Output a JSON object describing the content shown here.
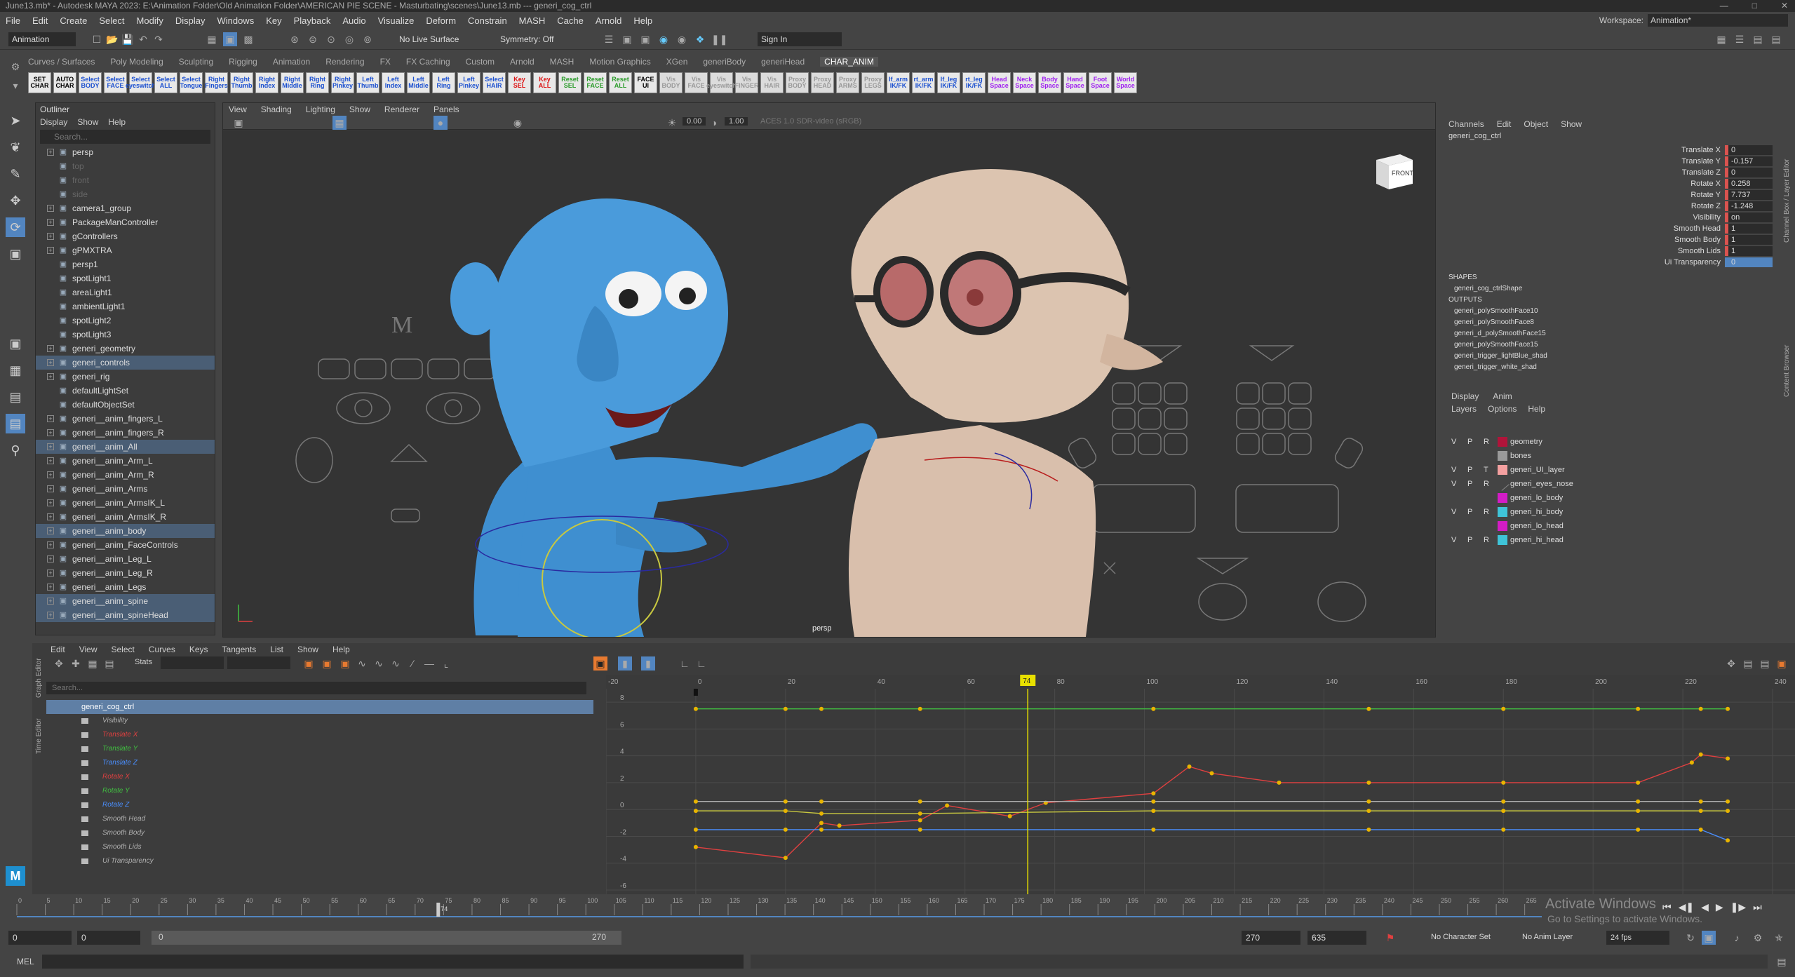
{
  "window": {
    "title": "June13.mb* - Autodesk MAYA 2023: E:\\Animation Folder\\Old Animation Folder\\AMERICAN PIE SCENE - Masturbating\\scenes\\June13.mb   ---   generi_cog_ctrl"
  },
  "menubar": {
    "items": [
      "File",
      "Edit",
      "Create",
      "Select",
      "Modify",
      "Display",
      "Windows",
      "Key",
      "Playback",
      "Audio",
      "Visualize",
      "Deform",
      "Constrain",
      "MASH",
      "Cache",
      "Arnold",
      "Help"
    ]
  },
  "workspace": {
    "label": "Workspace:",
    "value": "Animation*"
  },
  "statusline": {
    "mode": "Animation",
    "live_surface": "No Live Surface",
    "symmetry": "Symmetry: Off",
    "sign_in": "Sign In"
  },
  "shelf_tabs": {
    "items": [
      "Curves / Surfaces",
      "Poly Modeling",
      "Sculpting",
      "Rigging",
      "Animation",
      "Rendering",
      "FX",
      "FX Caching",
      "Custom",
      "Arnold",
      "MASH",
      "Motion Graphics",
      "XGen",
      "generiBody",
      "generiHead",
      "CHAR_ANIM"
    ],
    "active": "CHAR_ANIM"
  },
  "shelf_buttons": [
    {
      "label": "SET CHAR",
      "style": "k"
    },
    {
      "label": "AUTO CHAR",
      "style": "k"
    },
    {
      "label": "Select BODY",
      "style": ""
    },
    {
      "label": "Select FACE",
      "style": ""
    },
    {
      "label": "Select eyeswitch",
      "style": ""
    },
    {
      "label": "Select ALL",
      "style": ""
    },
    {
      "label": "Select Tongue",
      "style": ""
    },
    {
      "label": "Right Fingers",
      "style": ""
    },
    {
      "label": "Right Thumb",
      "style": ""
    },
    {
      "label": "Right Index",
      "style": ""
    },
    {
      "label": "Right Middle",
      "style": ""
    },
    {
      "label": "Right Ring",
      "style": ""
    },
    {
      "label": "Right Pinkey",
      "style": ""
    },
    {
      "label": "Left Thumb",
      "style": ""
    },
    {
      "label": "Left Index",
      "style": ""
    },
    {
      "label": "Left Middle",
      "style": ""
    },
    {
      "label": "Left Ring",
      "style": ""
    },
    {
      "label": "Left Pinkey",
      "style": ""
    },
    {
      "label": "Select HAIR",
      "style": ""
    },
    {
      "label": "Key SEL",
      "style": "r"
    },
    {
      "label": "Key ALL",
      "style": "r"
    },
    {
      "label": "Reset SEL",
      "style": "g"
    },
    {
      "label": "Reset FACE",
      "style": "g"
    },
    {
      "label": "Reset ALL",
      "style": "g"
    },
    {
      "label": "FACE UI",
      "style": "k"
    },
    {
      "label": "Vis BODY",
      "style": "gr"
    },
    {
      "label": "Vis FACE",
      "style": "gr"
    },
    {
      "label": "Vis eyeswitch",
      "style": "gr"
    },
    {
      "label": "Vis FINGER",
      "style": "gr"
    },
    {
      "label": "Vis HAIR",
      "style": "gr"
    },
    {
      "label": "Proxy BODY",
      "style": "gr"
    },
    {
      "label": "Proxy HEAD",
      "style": "gr"
    },
    {
      "label": "Proxy ARMS",
      "style": "gr"
    },
    {
      "label": "Proxy LEGS",
      "style": "gr"
    },
    {
      "label": "lf_arm IK/FK",
      "style": ""
    },
    {
      "label": "rt_arm IK/FK",
      "style": ""
    },
    {
      "label": "lf_leg IK/FK",
      "style": ""
    },
    {
      "label": "rt_leg IK/FK",
      "style": ""
    },
    {
      "label": "Head Space",
      "style": "p"
    },
    {
      "label": "Neck Space",
      "style": "p"
    },
    {
      "label": "Body Space",
      "style": "p"
    },
    {
      "label": "Hand Space",
      "style": "p"
    },
    {
      "label": "Foot Space",
      "style": "p"
    },
    {
      "label": "World Space",
      "style": "p"
    }
  ],
  "outliner": {
    "title": "Outliner",
    "menu": [
      "Display",
      "Show",
      "Help"
    ],
    "search_placeholder": "Search...",
    "items": [
      {
        "label": "persp",
        "hl": false,
        "dim": false,
        "exp": true
      },
      {
        "label": "top",
        "hl": false,
        "dim": true,
        "exp": false
      },
      {
        "label": "front",
        "hl": false,
        "dim": true,
        "exp": false
      },
      {
        "label": "side",
        "hl": false,
        "dim": true,
        "exp": false
      },
      {
        "label": "camera1_group",
        "hl": false,
        "dim": false,
        "exp": true
      },
      {
        "label": "PackageManController",
        "hl": false,
        "dim": false,
        "exp": true
      },
      {
        "label": "gControllers",
        "hl": false,
        "dim": false,
        "exp": true
      },
      {
        "label": "gPMXTRA",
        "hl": false,
        "dim": false,
        "exp": true
      },
      {
        "label": "persp1",
        "hl": false,
        "dim": false,
        "exp": false
      },
      {
        "label": "spotLight1",
        "hl": false,
        "dim": false,
        "exp": false
      },
      {
        "label": "areaLight1",
        "hl": false,
        "dim": false,
        "exp": false
      },
      {
        "label": "ambientLight1",
        "hl": false,
        "dim": false,
        "exp": false
      },
      {
        "label": "spotLight2",
        "hl": false,
        "dim": false,
        "exp": false
      },
      {
        "label": "spotLight3",
        "hl": false,
        "dim": false,
        "exp": false
      },
      {
        "label": "generi_geometry",
        "hl": false,
        "dim": false,
        "exp": true
      },
      {
        "label": "generi_controls",
        "hl": true,
        "dim": false,
        "exp": true
      },
      {
        "label": "generi_rig",
        "hl": false,
        "dim": false,
        "exp": true
      },
      {
        "label": "defaultLightSet",
        "hl": false,
        "dim": false,
        "exp": false
      },
      {
        "label": "defaultObjectSet",
        "hl": false,
        "dim": false,
        "exp": false
      },
      {
        "label": "generi__anim_fingers_L",
        "hl": false,
        "dim": false,
        "exp": true
      },
      {
        "label": "generi__anim_fingers_R",
        "hl": false,
        "dim": false,
        "exp": true
      },
      {
        "label": "generi__anim_All",
        "hl": true,
        "dim": false,
        "exp": true
      },
      {
        "label": "generi__anim_Arm_L",
        "hl": false,
        "dim": false,
        "exp": true
      },
      {
        "label": "generi__anim_Arm_R",
        "hl": false,
        "dim": false,
        "exp": true
      },
      {
        "label": "generi__anim_Arms",
        "hl": false,
        "dim": false,
        "exp": true
      },
      {
        "label": "generi__anim_ArmsIK_L",
        "hl": false,
        "dim": false,
        "exp": true
      },
      {
        "label": "generi__anim_ArmsIK_R",
        "hl": false,
        "dim": false,
        "exp": true
      },
      {
        "label": "generi__anim_body",
        "hl": true,
        "dim": false,
        "exp": true
      },
      {
        "label": "generi__anim_FaceControls",
        "hl": false,
        "dim": false,
        "exp": true
      },
      {
        "label": "generi__anim_Leg_L",
        "hl": false,
        "dim": false,
        "exp": true
      },
      {
        "label": "generi__anim_Leg_R",
        "hl": false,
        "dim": false,
        "exp": true
      },
      {
        "label": "generi__anim_Legs",
        "hl": false,
        "dim": false,
        "exp": true
      },
      {
        "label": "generi__anim_spine",
        "hl": true,
        "dim": false,
        "exp": true
      },
      {
        "label": "generi__anim_spineHead",
        "hl": true,
        "dim": false,
        "exp": true
      }
    ]
  },
  "viewport": {
    "menu": [
      "View",
      "Shading",
      "Lighting",
      "Show",
      "Renderer",
      "Panels"
    ],
    "exposure": "0.00",
    "gamma": "1.00",
    "colorspace": "ACES 1.0 SDR-video (sRGB)",
    "camera_label": "persp",
    "viewcube_label": "FRONT"
  },
  "channelbox": {
    "menu": [
      "Channels",
      "Edit",
      "Object",
      "Show"
    ],
    "object": "generi_cog_ctrl",
    "attrs": [
      {
        "label": "Translate X",
        "value": "0"
      },
      {
        "label": "Translate Y",
        "value": "-0.157"
      },
      {
        "label": "Translate Z",
        "value": "0"
      },
      {
        "label": "Rotate X",
        "value": "0.258"
      },
      {
        "label": "Rotate Y",
        "value": "7.737"
      },
      {
        "label": "Rotate Z",
        "value": "-1.248"
      },
      {
        "label": "Visibility",
        "value": "on"
      },
      {
        "label": "Smooth Head",
        "value": "1"
      },
      {
        "label": "Smooth Body",
        "value": "1"
      },
      {
        "label": "Smooth Lids",
        "value": "1"
      },
      {
        "label": "Ui Transparency",
        "value": "0"
      }
    ],
    "shapes_header": "SHAPES",
    "shapes": [
      "generi_cog_ctrlShape"
    ],
    "outputs_header": "OUTPUTS",
    "outputs": [
      "generi_polySmoothFace10",
      "generi_polySmoothFace8",
      "generi_d_polySmoothFace15",
      "generi_polySmoothFace15",
      "generi_trigger_lightBlue_shad",
      "generi_trigger_white_shad"
    ],
    "side_tabs": [
      "Channel Box / Layer Editor",
      "Content Browser"
    ]
  },
  "layers": {
    "tabs": [
      "Display",
      "Anim"
    ],
    "menu": [
      "Layers",
      "Options",
      "Help"
    ],
    "items": [
      {
        "v": "V",
        "p": "P",
        "r": "R",
        "color": "#b0143a",
        "name": "geometry"
      },
      {
        "v": "",
        "p": "",
        "r": "",
        "color": "#9a9a9a",
        "name": "bones"
      },
      {
        "v": "V",
        "p": "P",
        "r": "T",
        "color": "#f4a0a0",
        "name": "generi_UI_layer"
      },
      {
        "v": "V",
        "p": "P",
        "r": "R",
        "color": "",
        "name": "generi_eyes_nose"
      },
      {
        "v": "",
        "p": "",
        "r": "",
        "color": "#d41cc6",
        "name": "generi_lo_body"
      },
      {
        "v": "V",
        "p": "P",
        "r": "R",
        "color": "#3fc4d8",
        "name": "generi_hi_body"
      },
      {
        "v": "",
        "p": "",
        "r": "",
        "color": "#d41cc6",
        "name": "generi_lo_head"
      },
      {
        "v": "V",
        "p": "P",
        "r": "R",
        "color": "#3fc4d8",
        "name": "generi_hi_head"
      }
    ]
  },
  "graph_editor": {
    "menu": [
      "Edit",
      "View",
      "Select",
      "Curves",
      "Keys",
      "Tangents",
      "List",
      "Show",
      "Help"
    ],
    "stats_label": "Stats",
    "search_placeholder": "Search...",
    "side_labels": [
      "Graph Editor",
      "Time Editor"
    ],
    "selected_node": "generi_cog_ctrl",
    "curves": [
      {
        "label": "Visibility",
        "color": "#b0b0b0"
      },
      {
        "label": "Translate X",
        "color": "#e04040"
      },
      {
        "label": "Translate Y",
        "color": "#40c040"
      },
      {
        "label": "Translate Z",
        "color": "#4a8fff"
      },
      {
        "label": "Rotate X",
        "color": "#e04040"
      },
      {
        "label": "Rotate Y",
        "color": "#40c040"
      },
      {
        "label": "Rotate Z",
        "color": "#4a8fff"
      },
      {
        "label": "Smooth Head",
        "color": "#b0b0b0"
      },
      {
        "label": "Smooth Body",
        "color": "#b0b0b0"
      },
      {
        "label": "Smooth Lids",
        "color": "#b0b0b0"
      },
      {
        "label": "Ui Transparency",
        "color": "#b0b0b0"
      }
    ],
    "x_ticks": [
      "-20",
      "0",
      "20",
      "40",
      "60",
      "80",
      "100",
      "120",
      "140",
      "160",
      "180",
      "200",
      "220",
      "240"
    ],
    "y_ticks": [
      "8",
      "6",
      "4",
      "2",
      "0",
      "-2",
      "-4",
      "-6"
    ],
    "current_frame": "74"
  },
  "chart_data": {
    "type": "line",
    "title": "",
    "xlabel": "",
    "ylabel": "",
    "xlim": [
      -20,
      245
    ],
    "ylim": [
      -6,
      9
    ],
    "current_frame": 74,
    "series": [
      {
        "color": "#40c040",
        "x": [
          0,
          20,
          28,
          50,
          102,
          150,
          180,
          210,
          224,
          230
        ],
        "y": [
          7.5,
          7.5,
          7.5,
          7.5,
          7.5,
          7.5,
          7.5,
          7.5,
          7.5,
          7.5
        ]
      },
      {
        "color": "#e04040",
        "x": [
          0,
          20,
          28,
          32,
          50,
          56,
          70,
          78,
          102,
          110,
          115,
          130,
          150,
          180,
          210,
          222,
          224,
          230
        ],
        "y": [
          -2.8,
          -3.6,
          -1,
          -1.2,
          -0.8,
          0.3,
          -0.5,
          0.5,
          1.2,
          3.2,
          2.7,
          2,
          2,
          2,
          2,
          3.5,
          4.1,
          3.8
        ]
      },
      {
        "color": "#4a8fff",
        "x": [
          0,
          20,
          28,
          50,
          102,
          150,
          180,
          210,
          224,
          230
        ],
        "y": [
          -1.5,
          -1.5,
          -1.5,
          -1.5,
          -1.5,
          -1.5,
          -1.5,
          -1.5,
          -1.5,
          -2.3
        ]
      },
      {
        "color": "#b0b0b0",
        "x": [
          0,
          20,
          28,
          50,
          102,
          150,
          180,
          210,
          224,
          230
        ],
        "y": [
          0.6,
          0.6,
          0.6,
          0.6,
          0.6,
          0.6,
          0.6,
          0.6,
          0.6,
          0.6
        ]
      },
      {
        "color": "#c8c840",
        "x": [
          0,
          20,
          28,
          50,
          102,
          150,
          180,
          210,
          224,
          230
        ],
        "y": [
          -0.1,
          -0.1,
          -0.3,
          -0.3,
          -0.1,
          -0.1,
          -0.1,
          -0.1,
          -0.1,
          -0.1
        ]
      }
    ]
  },
  "timeslider": {
    "ticks": [
      "0",
      "5",
      "10",
      "15",
      "20",
      "25",
      "30",
      "35",
      "40",
      "45",
      "50",
      "55",
      "60",
      "65",
      "70",
      "75",
      "80",
      "85",
      "90",
      "95",
      "100",
      "105",
      "110",
      "115",
      "120",
      "125",
      "130",
      "135",
      "140",
      "145",
      "150",
      "155",
      "160",
      "165",
      "170",
      "175",
      "180",
      "185",
      "190",
      "195",
      "200",
      "205",
      "210",
      "215",
      "220",
      "225",
      "230",
      "235",
      "240",
      "245",
      "250",
      "255",
      "260",
      "265"
    ],
    "current": "74",
    "current_value": 74
  },
  "range": {
    "start_outer": "0",
    "start": "0",
    "range_start": "0",
    "range_end": "270",
    "end": "270",
    "end_outer": "635",
    "character_set": "No Character Set",
    "anim_layer": "No Anim Layer",
    "fps": "24 fps"
  },
  "cmdline": {
    "label": "MEL"
  },
  "watermark": {
    "line1": "Activate Windows",
    "line2": "Go to Settings to activate Windows."
  }
}
